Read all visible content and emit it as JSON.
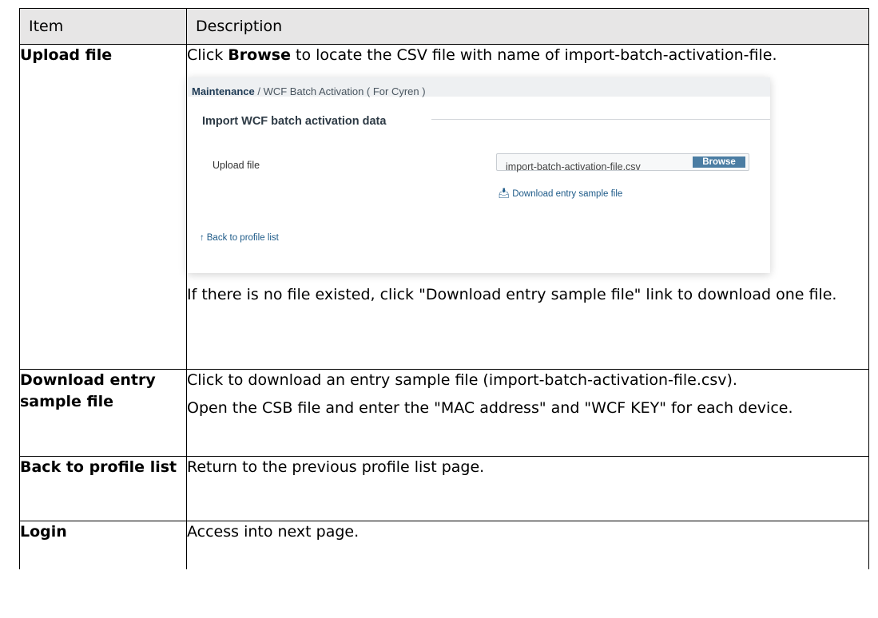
{
  "table": {
    "headers": {
      "item": "Item",
      "description": "Description"
    },
    "rows": {
      "upload": {
        "item": "Upload file",
        "desc_pre": "Click ",
        "desc_bold": "Browse",
        "desc_post": " to locate the CSV file with name of import-batch-activation-file.",
        "desc_after": "If there is no file existed, click \"Download entry sample file\" link to download one file."
      },
      "download": {
        "item": "Download entry sample file",
        "desc_1": "Click to download an entry sample file (import-batch-activation-file.csv).",
        "desc_2": "Open the CSB file and enter the \"MAC address\" and \"WCF KEY\" for each device."
      },
      "back": {
        "item": "Back to profile list",
        "desc": "Return to the previous profile list page."
      },
      "login": {
        "item": "Login",
        "desc": "Access into next page."
      }
    }
  },
  "screenshot": {
    "breadcrumb_root": "Maintenance",
    "breadcrumb_sep": " / ",
    "breadcrumb_page": "WCF Batch Activation ( For Cyren )",
    "section_title": "Import WCF batch activation data",
    "upload_label": "Upload file",
    "file_value": "import-batch-activation-file.csv",
    "browse_label": "Browse",
    "download_link": "Download entry sample file",
    "download_icon": "download-tray-icon",
    "back_link": "Back to profile list",
    "back_icon": "arrow-up-icon"
  }
}
